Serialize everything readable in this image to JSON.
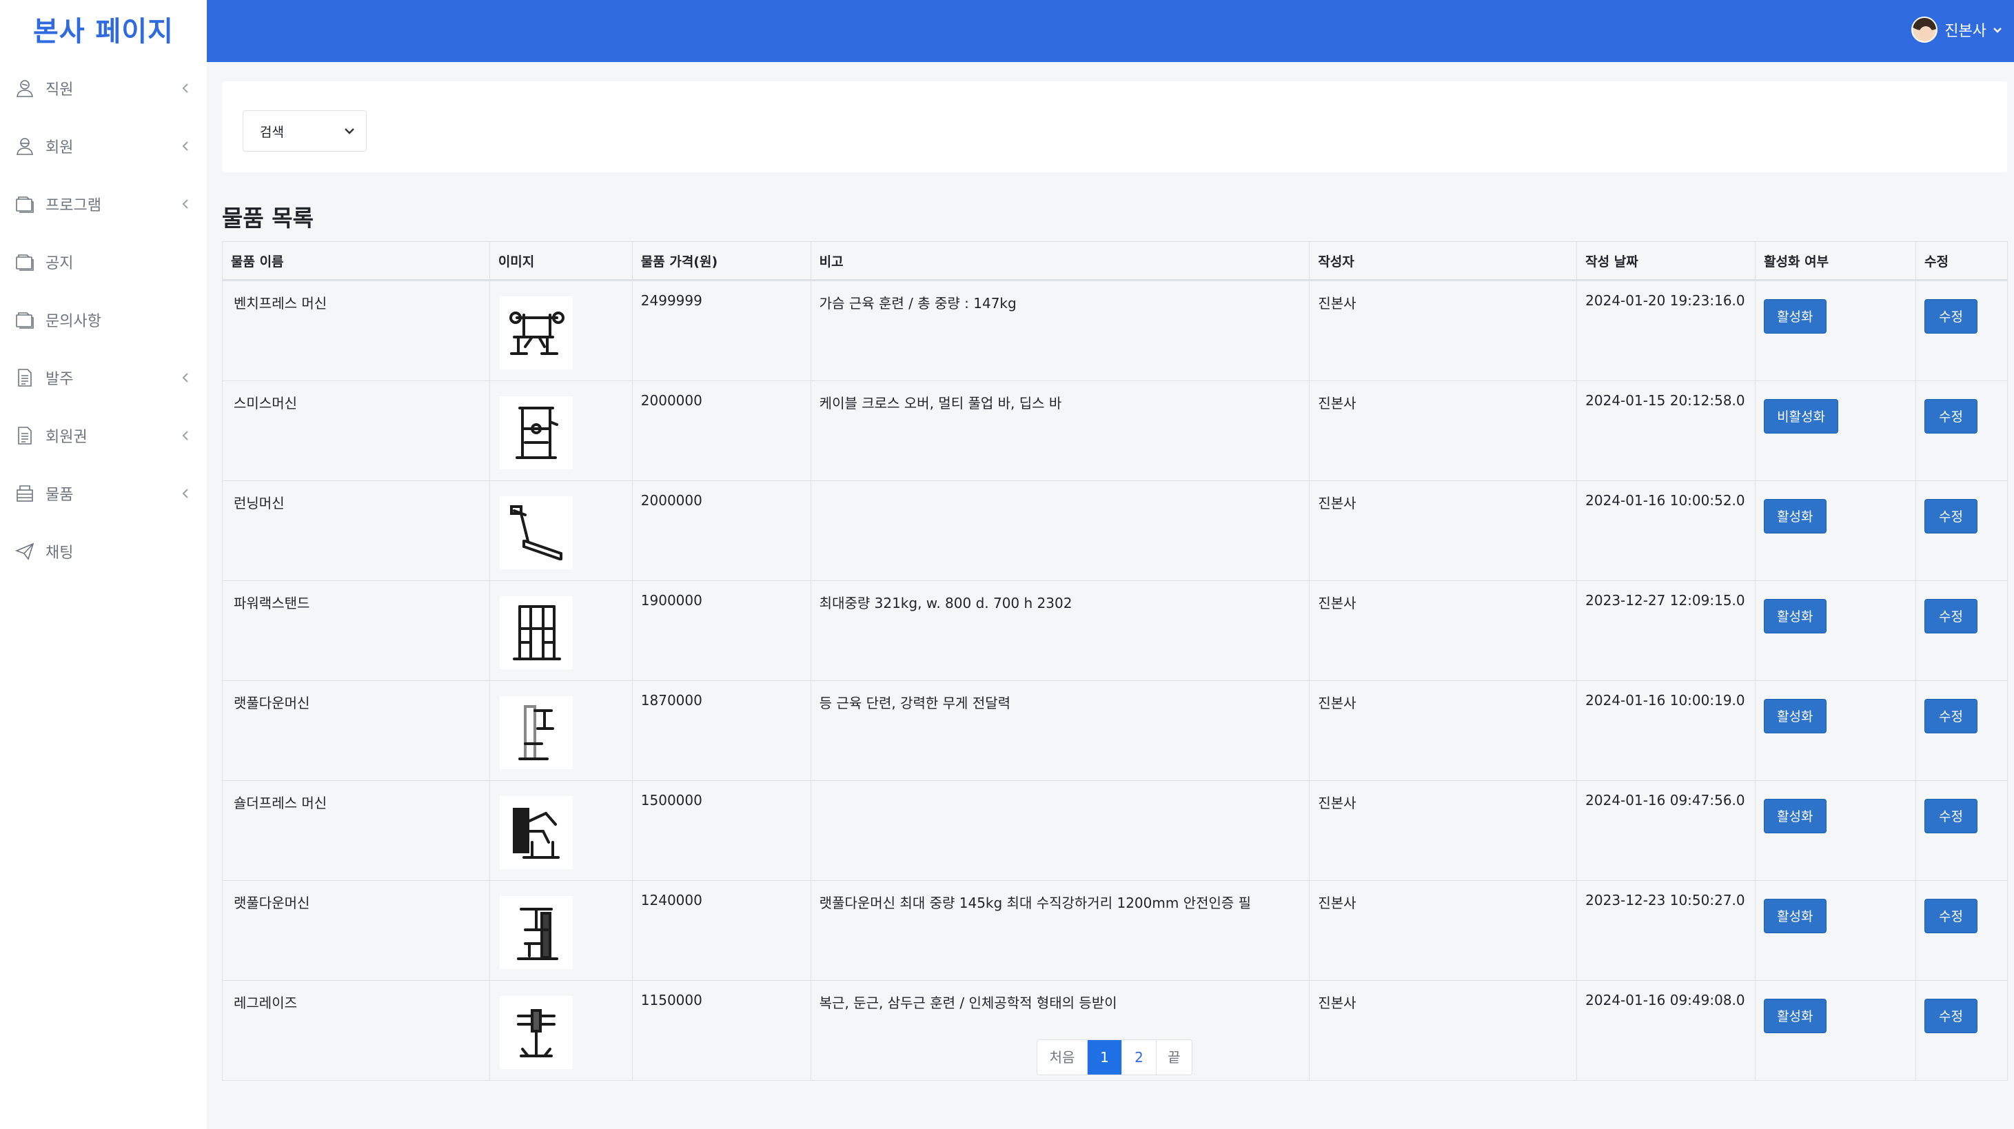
{
  "brand": "본사 페이지",
  "sidebar": {
    "items": [
      {
        "label": "직원",
        "icon": "staff-icon",
        "chevron": true
      },
      {
        "label": "회원",
        "icon": "member-icon",
        "chevron": true
      },
      {
        "label": "프로그램",
        "icon": "folder-icon",
        "chevron": true
      },
      {
        "label": "공지",
        "icon": "folder-icon",
        "chevron": false
      },
      {
        "label": "문의사항",
        "icon": "folder-icon",
        "chevron": false
      },
      {
        "label": "발주",
        "icon": "document-icon",
        "chevron": true
      },
      {
        "label": "회원권",
        "icon": "document-icon",
        "chevron": true
      },
      {
        "label": "물품",
        "icon": "box-icon",
        "chevron": true
      },
      {
        "label": "채팅",
        "icon": "send-icon",
        "chevron": false
      }
    ]
  },
  "header": {
    "user_name": "진본사"
  },
  "search": {
    "select_label": "검색"
  },
  "list": {
    "title": "물품 목록",
    "columns": [
      "물품 이름",
      "이미지",
      "물품 가격(원)",
      "비고",
      "작성자",
      "작성 날짜",
      "활성화 여부",
      "수정"
    ],
    "rows": [
      {
        "name": "벤치프레스 머신",
        "image": "bench-press-image",
        "price": "2499999",
        "note": "가슴 근육 훈련 / 총 중량 : 147kg",
        "author": "진본사",
        "date": "2024-01-20 19:23:16.0",
        "status": "활성화",
        "edit": "수정"
      },
      {
        "name": "스미스머신",
        "image": "smith-machine-image",
        "price": "2000000",
        "note": "케이블 크로스 오버, 멀티 풀업 바, 딥스 바",
        "author": "진본사",
        "date": "2024-01-15 20:12:58.0",
        "status": "비활성화",
        "edit": "수정"
      },
      {
        "name": "런닝머신",
        "image": "treadmill-image",
        "price": "2000000",
        "note": "",
        "author": "진본사",
        "date": "2024-01-16 10:00:52.0",
        "status": "활성화",
        "edit": "수정"
      },
      {
        "name": "파워랙스탠드",
        "image": "power-rack-image",
        "price": "1900000",
        "note": "최대중량 321kg, w. 800 d. 700 h 2302",
        "author": "진본사",
        "date": "2023-12-27 12:09:15.0",
        "status": "활성화",
        "edit": "수정"
      },
      {
        "name": "랫풀다운머신",
        "image": "lat-pulldown-image",
        "price": "1870000",
        "note": "등 근육 단련, 강력한 무게 전달력",
        "author": "진본사",
        "date": "2024-01-16 10:00:19.0",
        "status": "활성화",
        "edit": "수정"
      },
      {
        "name": "숄더프레스 머신",
        "image": "shoulder-press-image",
        "price": "1500000",
        "note": "",
        "author": "진본사",
        "date": "2024-01-16 09:47:56.0",
        "status": "활성화",
        "edit": "수정"
      },
      {
        "name": "랫풀다운머신",
        "image": "lat-pulldown-image",
        "price": "1240000",
        "note": "랫풀다운머신 최대 중량 145kg 최대 수직강하거리 1200mm 안전인증 필",
        "author": "진본사",
        "date": "2023-12-23 10:50:27.0",
        "status": "활성화",
        "edit": "수정"
      },
      {
        "name": "레그레이즈",
        "image": "leg-raise-image",
        "price": "1150000",
        "note": "복근, 둔근, 삼두근 훈련 / 인체공학적 형태의 등받이",
        "author": "진본사",
        "date": "2024-01-16 09:49:08.0",
        "status": "활성화",
        "edit": "수정"
      }
    ]
  },
  "pagination": {
    "first": "처음",
    "pages": [
      "1",
      "2"
    ],
    "active": "1",
    "last": "끝"
  },
  "colors": {
    "accent": "#2f6bdf",
    "button": "#2d73c9"
  }
}
